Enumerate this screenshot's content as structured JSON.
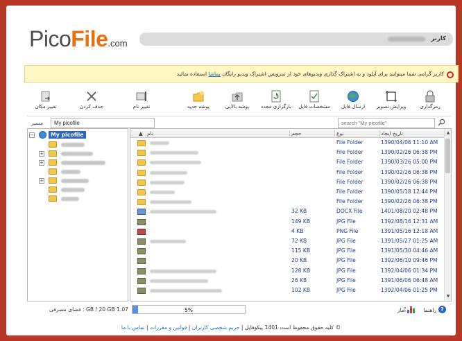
{
  "logo": {
    "part1": "Pico",
    "part2": "File",
    "domain": ".com"
  },
  "header": {
    "user_label": "کاربر"
  },
  "notice": {
    "text_before": "کاربر گرامی شما میتوانید برای آپلود و به اشتراک گذاری ویدیوهای خود از سرویس اشتراک ویدیو رایگان ",
    "link": "بماشا",
    "text_after": " استفاده نمائید"
  },
  "toolbar": {
    "items": [
      {
        "label": "رمزگذاری",
        "icon": "lock-icon"
      },
      {
        "label": "ویرایش تصویر",
        "icon": "crop-icon"
      },
      {
        "label": "ارسال فایل",
        "icon": "globe-send-icon"
      },
      {
        "label": "مشخصات فایل",
        "icon": "file-properties-icon"
      },
      {
        "label": "بارگزاری مجدد",
        "icon": "refresh-icon"
      },
      {
        "label": "پوشه بالایی",
        "icon": "folder-up-icon"
      },
      {
        "label": "پوشه جدید",
        "icon": "new-folder-icon"
      },
      {
        "label": "تغییر نام",
        "icon": "rename-icon"
      },
      {
        "label": "حذف کردن",
        "icon": "delete-icon"
      },
      {
        "label": "تغییر مکان",
        "icon": "move-icon"
      }
    ]
  },
  "path": {
    "label": "مسیر",
    "value": "My picofile"
  },
  "search": {
    "placeholder": "search \"My picofile\""
  },
  "tree": {
    "root": "My picofile"
  },
  "list": {
    "columns": {
      "name": "نام",
      "size": "حجم",
      "type": "نوع",
      "date": "تاریخ ایجاد"
    },
    "rows": [
      {
        "icon": "folder",
        "size": "",
        "type": "File Folder",
        "date": "1390/04/06 11:10 AM"
      },
      {
        "icon": "folder",
        "size": "",
        "type": "File Folder",
        "date": "1390/02/26 06:38 PM"
      },
      {
        "icon": "folder",
        "size": "",
        "type": "File Folder",
        "date": "1390/03/26 05:00 PM"
      },
      {
        "icon": "folder",
        "size": "",
        "type": "File Folder",
        "date": "1390/02/26 06:38 PM"
      },
      {
        "icon": "folder",
        "size": "",
        "type": "File Folder",
        "date": "1390/02/26 06:38 PM"
      },
      {
        "icon": "folder",
        "size": "",
        "type": "File Folder",
        "date": "1390/05/18 12:44 PM"
      },
      {
        "icon": "folder",
        "size": "",
        "type": "File Folder",
        "date": "1390/02/26 06:38 PM"
      },
      {
        "icon": "doc",
        "size": "32 KB",
        "type": "DOCX File",
        "date": "1401/08/20 02:48 PM"
      },
      {
        "icon": "jpg",
        "size": "149 KB",
        "type": "JPG File",
        "date": "1392/08/16 12:31 AM"
      },
      {
        "icon": "png",
        "size": "4 KB",
        "type": "PNG File",
        "date": "1391/05/16 12:18 AM"
      },
      {
        "icon": "jpg",
        "size": "72 KB",
        "type": "JPG File",
        "date": "1391/05/27 01:25 AM"
      },
      {
        "icon": "jpg",
        "size": "115 KB",
        "type": "JPG File",
        "date": "1391/05/30 04:46 AM"
      },
      {
        "icon": "jpg",
        "size": "20 KB",
        "type": "JPG File",
        "date": "1392/06/10 09:46 PM"
      },
      {
        "icon": "jpg",
        "size": "128 KB",
        "type": "JPG File",
        "date": "1392/04/06 01:34 PM"
      },
      {
        "icon": "jpg",
        "size": "26 KB",
        "type": "JPG File",
        "date": "1391/06/06 06:48 AM"
      },
      {
        "icon": "jpg",
        "size": "102 KB",
        "type": "JPG File",
        "date": "1392/04/06 01:25 PM"
      }
    ]
  },
  "quota": {
    "text": "1.07 GB / 20 GB : فضای مصرفی",
    "percent": 5,
    "percent_label": "5%"
  },
  "bottomnav": {
    "help": "راهنما",
    "stats": "آمار"
  },
  "footer": {
    "copyright": "© کلیه حقوق محفوظ است 1401 پیکوفایل | ",
    "privacy": "حریم شخصی کاربران",
    "sep1": " | ",
    "terms": "قوانین و مقررات",
    "sep2": " | ",
    "contact": "تماس با ما"
  },
  "colors": {
    "accent": "#e8700d",
    "frame": "#b8392a",
    "link": "#1a6fc4",
    "selection": "#2a64c8"
  }
}
